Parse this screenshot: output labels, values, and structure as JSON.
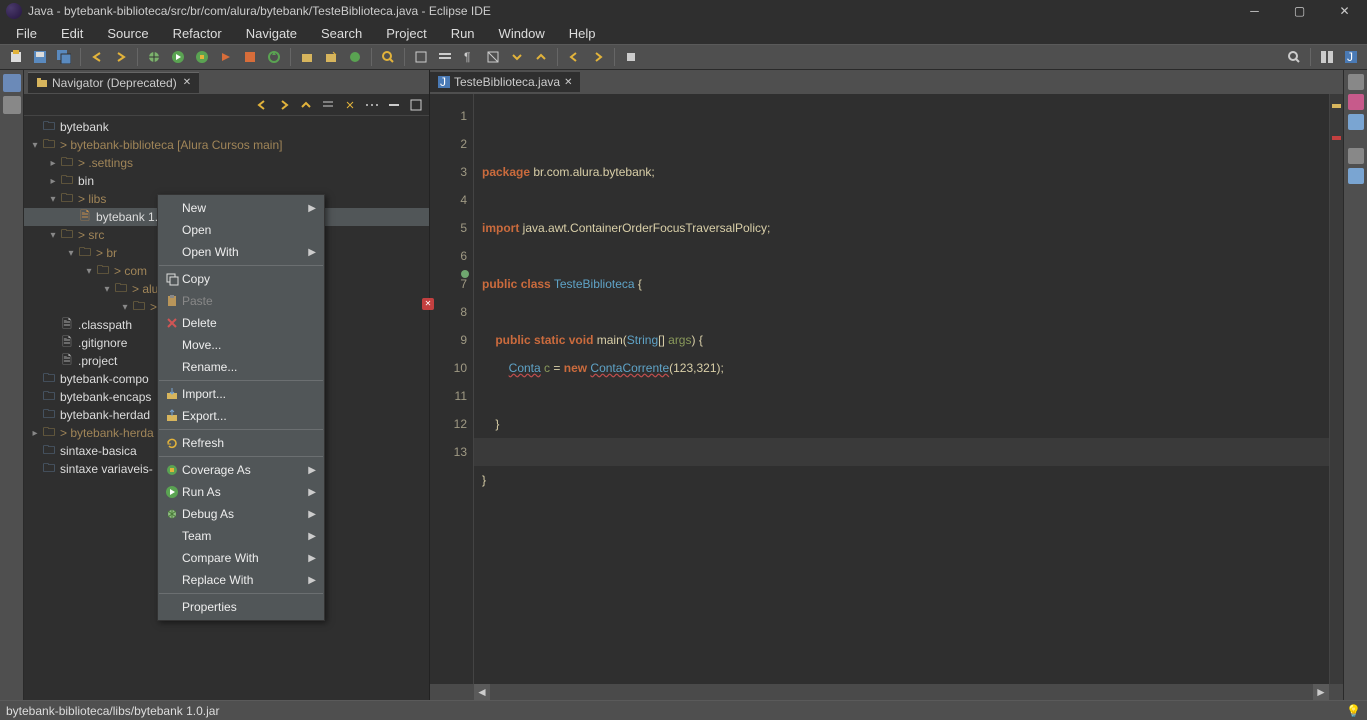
{
  "window": {
    "title": "Java - bytebank-biblioteca/src/br/com/alura/bytebank/TesteBiblioteca.java - Eclipse IDE"
  },
  "menus": [
    "File",
    "Edit",
    "Source",
    "Refactor",
    "Navigate",
    "Search",
    "Project",
    "Run",
    "Window",
    "Help"
  ],
  "navigator": {
    "tab_label": "Navigator (Deprecated)",
    "tree": {
      "root1": "bytebank",
      "proj": "> bytebank-biblioteca [Alura Cursos main]",
      "settings": "> .settings",
      "bin": "bin",
      "libs": "> libs",
      "jar": "bytebank 1.0",
      "src": "> src",
      "br": "> br",
      "com": "> com",
      "alu": "> alu",
      "pkgleaf": ">",
      "classpath": ".classpath",
      "gitignore": ".gitignore",
      "project": ".project",
      "compo": "bytebank-compo",
      "encaps": "bytebank-encaps",
      "herdad": "bytebank-herdad",
      "herdag": "> bytebank-herda",
      "sintaxe": "sintaxe-basica",
      "sintaxev": "sintaxe variaveis-"
    }
  },
  "editor": {
    "tab_label": "TesteBiblioteca.java",
    "lines": [
      "1",
      "2",
      "3",
      "4",
      "5",
      "6",
      "7",
      "8",
      "9",
      "10",
      "11",
      "12",
      "13"
    ]
  },
  "code": {
    "l1_kw": "package",
    "l1_rest": " br.com.alura.bytebank;",
    "l3_kw": "import",
    "l3_rest": " java.awt.ContainerOrderFocusTraversalPolicy;",
    "l5_kw1": "public",
    "l5_kw2": "class",
    "l5_cls": "TesteBiblioteca",
    "l5_rest": " {",
    "l7_kw1": "public",
    "l7_kw2": "static",
    "l7_kw3": "void",
    "l7_m": "main",
    "l7_str": "String",
    "l7_args": "args",
    "l8_cls1": "Conta",
    "l8_var": "c",
    "l8_kw": "new",
    "l8_cls2": "ContaCorrente",
    "l8_args": "(123,321);",
    "l10": "    }",
    "l12": "}"
  },
  "context_menu": [
    {
      "label": "New",
      "arrow": true,
      "icon": ""
    },
    {
      "label": "Open",
      "icon": ""
    },
    {
      "label": "Open With",
      "arrow": true,
      "icon": ""
    },
    {
      "sep": true
    },
    {
      "label": "Copy",
      "icon": "copy"
    },
    {
      "label": "Paste",
      "icon": "paste",
      "disabled": true
    },
    {
      "label": "Delete",
      "icon": "delete"
    },
    {
      "label": "Move...",
      "icon": ""
    },
    {
      "label": "Rename...",
      "icon": ""
    },
    {
      "sep": true
    },
    {
      "label": "Import...",
      "icon": "import"
    },
    {
      "label": "Export...",
      "icon": "export"
    },
    {
      "sep": true
    },
    {
      "label": "Refresh",
      "icon": "refresh"
    },
    {
      "sep": true
    },
    {
      "label": "Coverage As",
      "arrow": true,
      "icon": "coverage"
    },
    {
      "label": "Run As",
      "arrow": true,
      "icon": "run"
    },
    {
      "label": "Debug As",
      "arrow": true,
      "icon": "debug"
    },
    {
      "label": "Team",
      "arrow": true,
      "icon": ""
    },
    {
      "label": "Compare With",
      "arrow": true,
      "icon": ""
    },
    {
      "label": "Replace With",
      "arrow": true,
      "icon": ""
    },
    {
      "sep": true
    },
    {
      "label": "Properties",
      "icon": ""
    }
  ],
  "status": {
    "path": "bytebank-biblioteca/libs/bytebank 1.0.jar"
  }
}
